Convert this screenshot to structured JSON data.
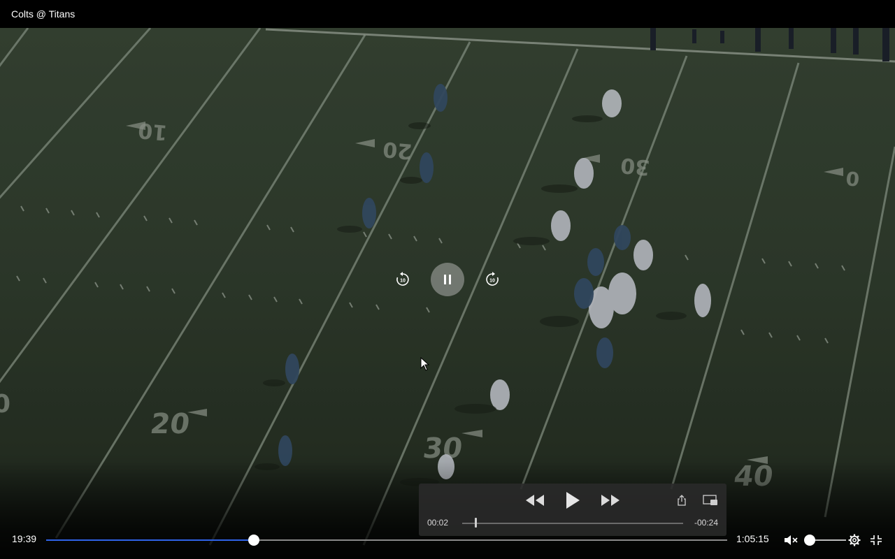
{
  "window": {
    "title": "Colts @ Titans"
  },
  "scene": {
    "description_icon": "football-field-broadcast"
  },
  "overlay": {
    "skip_back_icon": "skip-back-10-icon",
    "pause_icon": "pause-icon",
    "skip_forward_icon": "skip-forward-10-icon"
  },
  "mini_player": {
    "elapsed": "00:02",
    "remaining": "-00:24",
    "progress_fraction": 0.06
  },
  "player": {
    "elapsed": "19:39",
    "duration": "1:05:15",
    "progress_fraction": 0.305,
    "volume_fraction": 0.0,
    "muted": true
  },
  "colors": {
    "accent": "#2f63e8",
    "field": "#3a4836"
  }
}
